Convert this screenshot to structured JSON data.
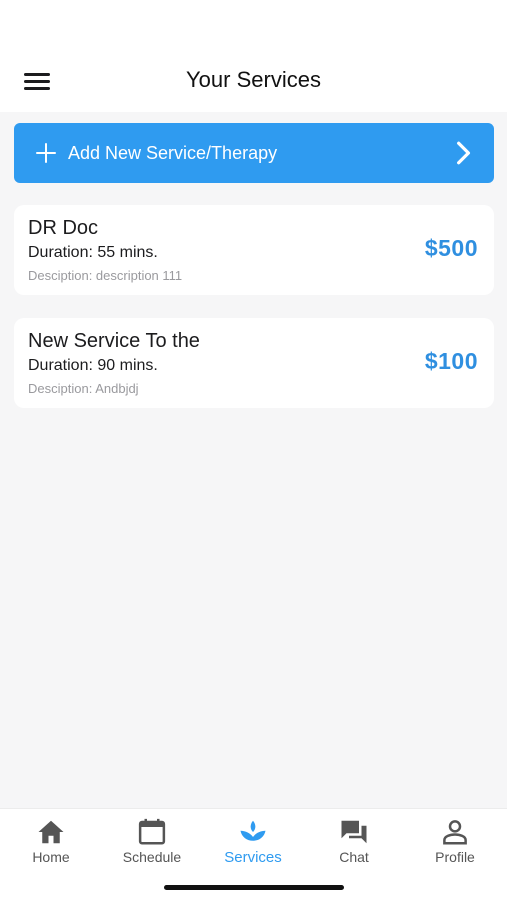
{
  "header": {
    "title": "Your Services",
    "menu_icon": "hamburger-menu-icon"
  },
  "add_service": {
    "label": "Add New Service/Therapy",
    "icon_left": "plus-icon",
    "icon_right": "chevron-right-icon"
  },
  "services": [
    {
      "name": "DR Doc",
      "duration": "Duration: 55 mins.",
      "description": "Desciption: description 111",
      "price": "$500"
    },
    {
      "name": "New Service To the",
      "duration": "Duration: 90 mins.",
      "description": "Desciption: Andbjdj",
      "price": "$100"
    }
  ],
  "tabbar": {
    "active": "Services",
    "items": [
      {
        "label": "Home",
        "icon": "home-icon"
      },
      {
        "label": "Schedule",
        "icon": "calendar-icon"
      },
      {
        "label": "Services",
        "icon": "lotus-icon"
      },
      {
        "label": "Chat",
        "icon": "chat-icon"
      },
      {
        "label": "Profile",
        "icon": "profile-icon"
      }
    ]
  },
  "colors": {
    "accent": "#2f9bf0",
    "price": "#2f8fe0",
    "background": "#f6f6f7"
  }
}
